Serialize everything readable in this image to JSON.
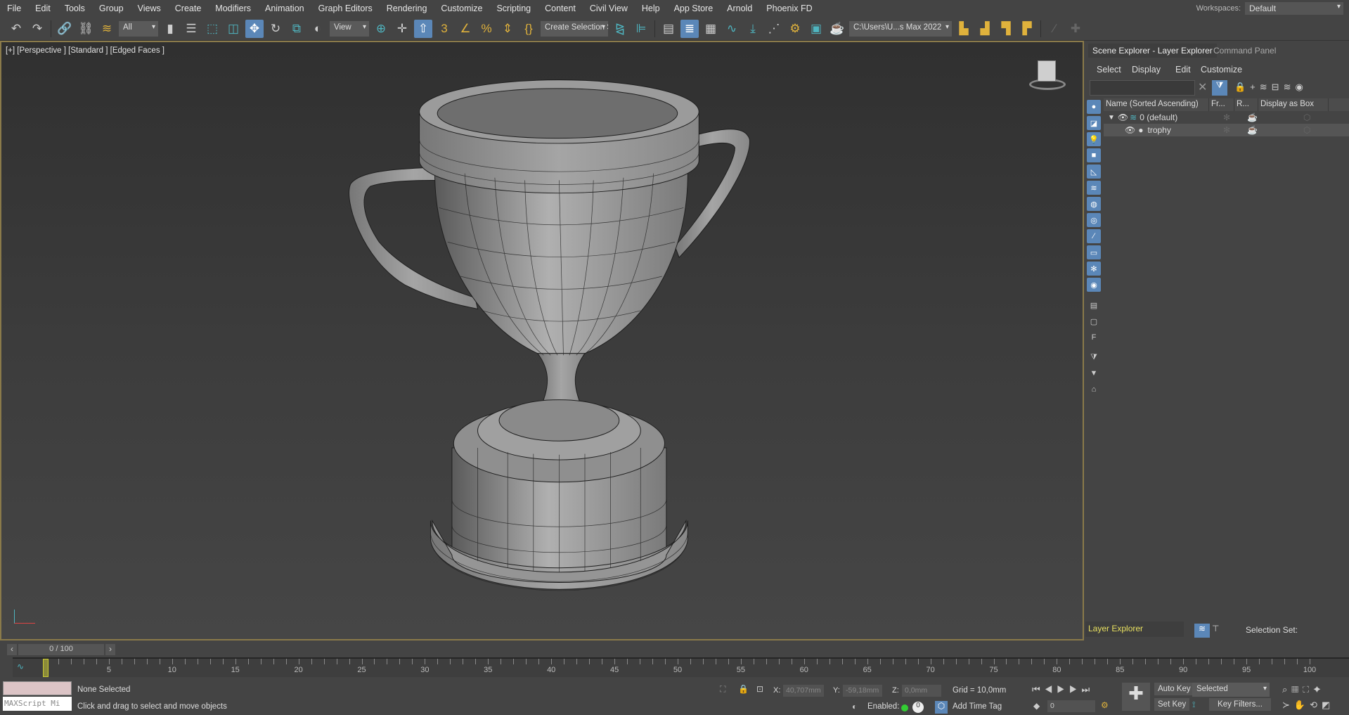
{
  "menu": [
    "File",
    "Edit",
    "Tools",
    "Group",
    "Views",
    "Create",
    "Modifiers",
    "Animation",
    "Graph Editors",
    "Rendering",
    "Customize",
    "Scripting",
    "Content",
    "Civil View",
    "Help",
    "App Store",
    "Arnold",
    "Phoenix FD"
  ],
  "workspaces": {
    "label": "Workspaces:",
    "value": "Default"
  },
  "toolbar": {
    "selection_filter": "All",
    "ref_coord": "View",
    "named_selection": "Create Selection Se",
    "project_path": "C:\\Users\\U...s Max 2022"
  },
  "viewport": {
    "label": "[+] [Perspective ] [Standard ] [Edged Faces ]"
  },
  "panel": {
    "tabs": [
      "Scene Explorer - Layer Explorer",
      "Command Panel"
    ],
    "menu": [
      "Select",
      "Display",
      "Edit",
      "Customize"
    ],
    "columns": [
      "Name (Sorted Ascending)",
      "Fr...",
      "R...",
      "Display as Box"
    ],
    "rows": [
      {
        "name": "0 (default)"
      },
      {
        "name": "trophy"
      }
    ],
    "explorer_select": "Layer Explorer",
    "selection_set_label": "Selection Set:"
  },
  "timeline": {
    "counter": "0 / 100",
    "start": 0,
    "end": 100,
    "current": 0
  },
  "status": {
    "listener": "MAXScript Mi",
    "selection": "None Selected",
    "prompt": "Click and drag to select and move objects",
    "x_label": "X:",
    "x": "40,707mm",
    "y_label": "Y:",
    "y": "-59,18mm",
    "z_label": "Z:",
    "z": "0,0mm",
    "grid": "Grid = 10,0mm",
    "enabled": "Enabled:",
    "add_time_tag": "Add Time Tag",
    "auto_key": "Auto Key",
    "set_key": "Set Key",
    "key_mode": "Selected",
    "key_filters": "Key Filters...",
    "frame": "0"
  }
}
